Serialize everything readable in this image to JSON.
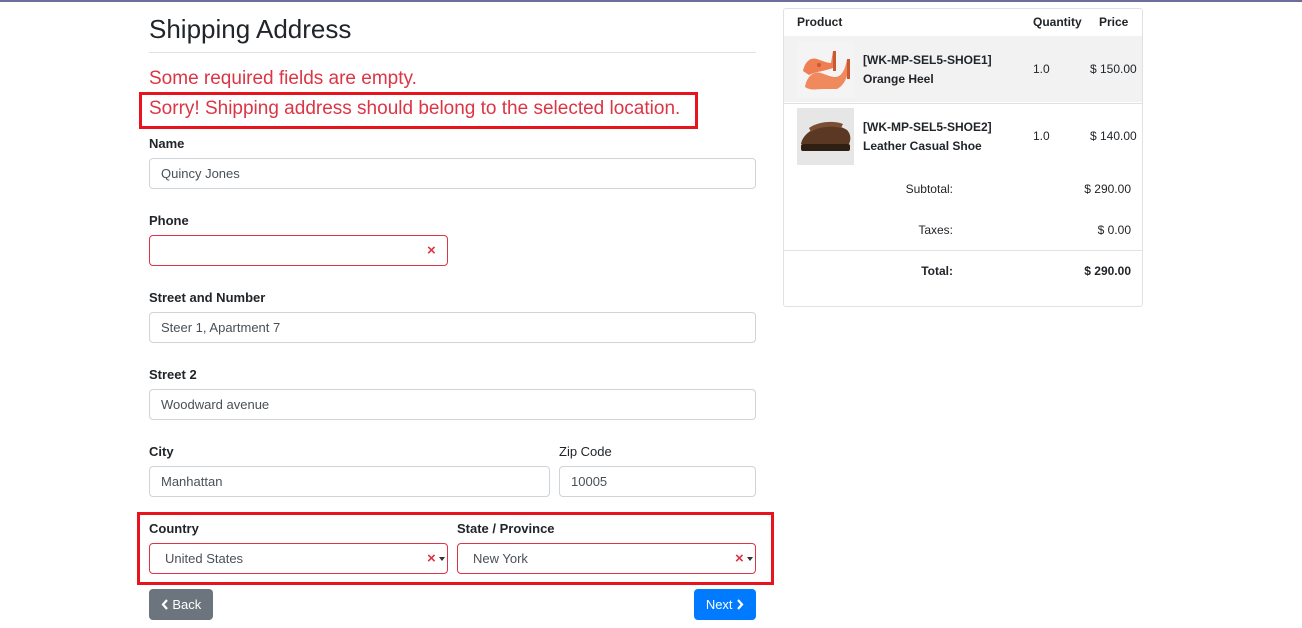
{
  "page_title": "Shipping Address",
  "errors": {
    "required": "Some required fields are empty.",
    "location": "Sorry! Shipping address should belong to the selected location."
  },
  "form": {
    "name": {
      "label": "Name",
      "value": "Quincy Jones"
    },
    "phone": {
      "label": "Phone",
      "value": ""
    },
    "street": {
      "label": "Street and Number",
      "value": "Steer 1, Apartment 7"
    },
    "street2": {
      "label": "Street 2",
      "value": "Woodward avenue"
    },
    "city": {
      "label": "City",
      "value": "Manhattan"
    },
    "zip": {
      "label": "Zip Code",
      "value": "10005"
    },
    "country": {
      "label": "Country",
      "value": "United States"
    },
    "state": {
      "label": "State / Province",
      "value": "New York"
    },
    "clear_glyph": "×"
  },
  "buttons": {
    "back": "Back",
    "next": "Next",
    "back_icon": "chevron-left-icon",
    "next_icon": "chevron-right-icon"
  },
  "cart": {
    "headers": {
      "product": "Product",
      "quantity": "Quantity",
      "price": "Price"
    },
    "items": [
      {
        "code": "[WK-MP-SEL5-SHOE1]",
        "name": "Orange Heel",
        "quantity": "1.0",
        "price": "$ 150.00",
        "image": "orange-heel-image"
      },
      {
        "code": "[WK-MP-SEL5-SHOE2]",
        "name": "Leather Casual Shoe",
        "quantity": "1.0",
        "price": "$ 140.00",
        "image": "leather-shoe-image"
      }
    ],
    "subtotal": {
      "label": "Subtotal:",
      "value": "$ 290.00"
    },
    "taxes": {
      "label": "Taxes:",
      "value": "$ 0.00"
    },
    "total": {
      "label": "Total:",
      "value": "$ 290.00"
    }
  },
  "colors": {
    "error": "#dc3545",
    "annotation": "#e8141d",
    "primary": "#007bff",
    "secondary": "#6c757d"
  }
}
